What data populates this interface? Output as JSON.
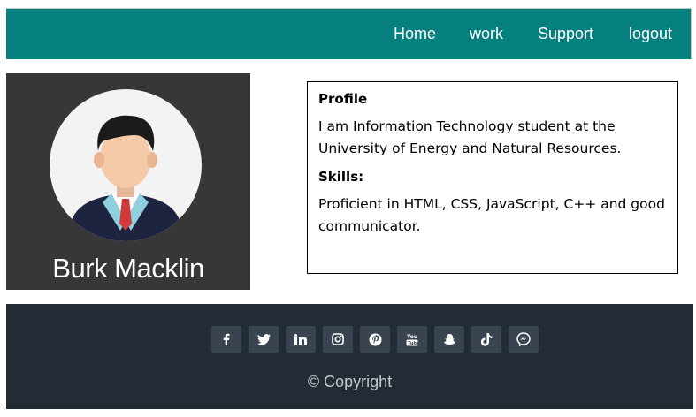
{
  "nav": {
    "items": [
      {
        "label": "Home"
      },
      {
        "label": "work"
      },
      {
        "label": "Support"
      },
      {
        "label": "logout"
      }
    ]
  },
  "profile": {
    "name": "Burk Macklin"
  },
  "info": {
    "profile_heading": "Profile",
    "profile_text": "I am Information Technology student at the University of Energy and Natural Resources.",
    "skills_heading": "Skills:",
    "skills_text": "Proficient in HTML, CSS, JavaScript, C++ and good communicator."
  },
  "footer": {
    "social_icons": [
      "facebook-icon",
      "twitter-icon",
      "linkedin-icon",
      "instagram-icon",
      "pinterest-icon",
      "youtube-icon",
      "snapchat-icon",
      "tiktok-icon",
      "messenger-icon"
    ],
    "copyright": "© Copyright"
  },
  "colors": {
    "navbar": "#067f7f",
    "profile_card": "#373737",
    "footer": "#232b34"
  }
}
